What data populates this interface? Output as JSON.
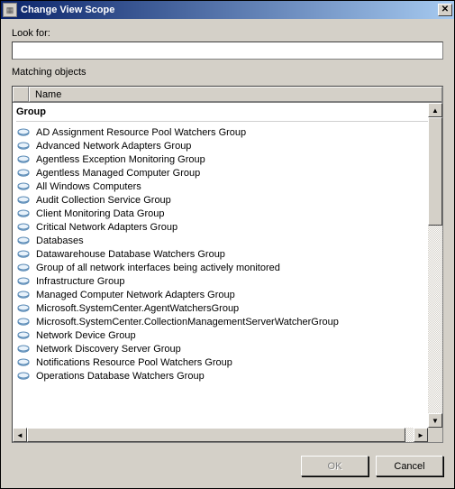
{
  "window": {
    "title": "Change View Scope"
  },
  "lookFor": {
    "label": "Look for:",
    "value": ""
  },
  "matching": {
    "label": "Matching objects",
    "column": "Name",
    "groupHeader": "Group",
    "items": [
      "AD Assignment Resource Pool Watchers Group",
      "Advanced Network Adapters Group",
      "Agentless Exception Monitoring Group",
      "Agentless Managed Computer Group",
      "All Windows Computers",
      "Audit Collection Service Group",
      "Client Monitoring Data Group",
      "Critical Network Adapters Group",
      "Databases",
      "Datawarehouse Database Watchers Group",
      "Group of all network interfaces being actively monitored",
      "Infrastructure Group",
      "Managed Computer Network Adapters Group",
      "Microsoft.SystemCenter.AgentWatchersGroup",
      "Microsoft.SystemCenter.CollectionManagementServerWatcherGroup",
      "Network Device Group",
      "Network Discovery Server Group",
      "Notifications Resource Pool Watchers Group",
      "Operations Database Watchers Group"
    ]
  },
  "buttons": {
    "ok": "OK",
    "cancel": "Cancel"
  }
}
